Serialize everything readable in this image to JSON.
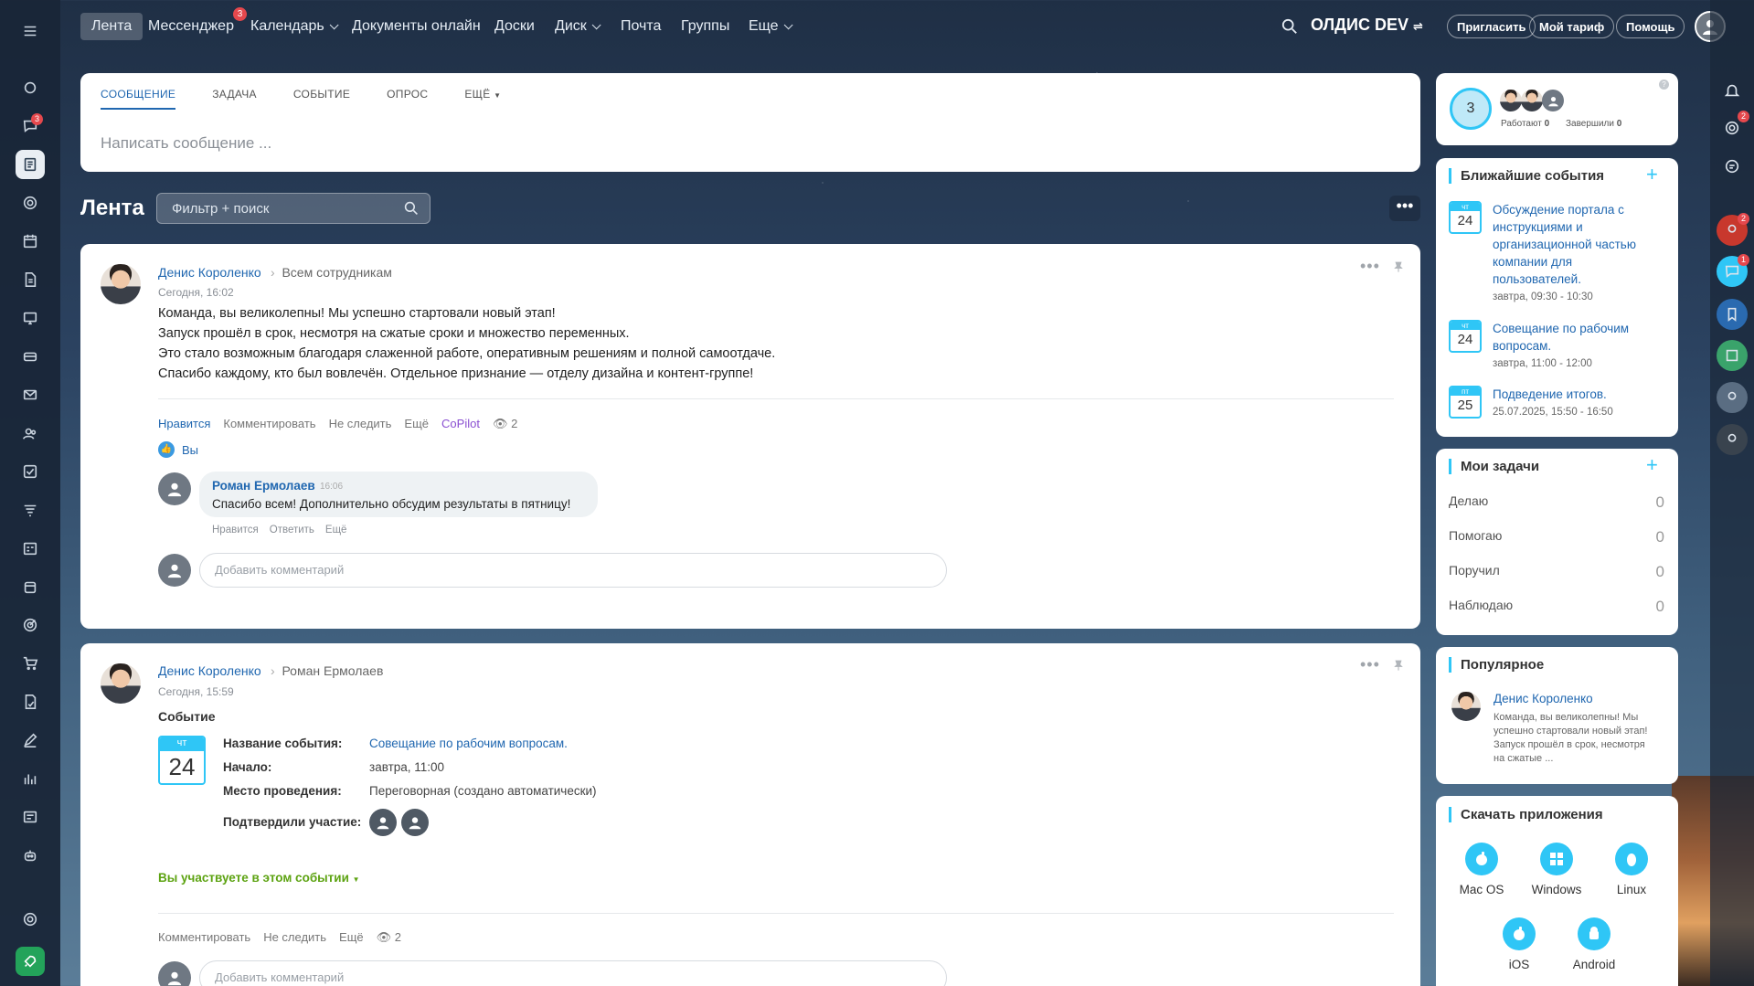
{
  "nav": {
    "items": [
      {
        "label": "Лента",
        "active": true
      },
      {
        "label": "Мессенджер",
        "badge": "3"
      },
      {
        "label": "Календарь",
        "caret": true
      },
      {
        "label": "Документы онлайн"
      },
      {
        "label": "Доски"
      },
      {
        "label": "Диск",
        "caret": true
      },
      {
        "label": "Почта"
      },
      {
        "label": "Группы"
      },
      {
        "label": "Еще",
        "caret": true
      }
    ],
    "brand": "ОЛДИС DEV",
    "invite": "Пригласить",
    "tariff": "Мой тариф",
    "help": "Помощь"
  },
  "left_rail_badge": "3",
  "composer": {
    "tabs": [
      "СООБЩЕНИЕ",
      "ЗАДАЧА",
      "СОБЫТИЕ",
      "ОПРОС",
      "ЕЩЁ"
    ],
    "placeholder": "Написать сообщение ..."
  },
  "feed": {
    "title": "Лента",
    "filter_placeholder": "Фильтр + поиск"
  },
  "post1": {
    "author": "Денис Короленко",
    "to": "Всем сотрудникам",
    "time": "Сегодня, 16:02",
    "lines": [
      "Команда, вы великолепны! Мы успешно стартовали новый этап!",
      "Запуск прошёл в срок, несмотря на сжатые сроки и множество переменных.",
      "Это стало возможным благодаря слаженной работе, оперативным решениям и полной самоотдаче.",
      "Спасибо каждому, кто был вовлечён. Отдельное признание — отделу дизайна и контент-группе!"
    ],
    "actions": {
      "like": "Нравится",
      "comment": "Комментировать",
      "unfollow": "Не следить",
      "more": "Ещё",
      "copilot": "CoPilot",
      "views": "2"
    },
    "liked_by": "Вы",
    "comment": {
      "author": "Роман Ермолаев",
      "time": "16:06",
      "text": "Спасибо всем! Дополнительно обсудим результаты в пятницу!",
      "actions": [
        "Нравится",
        "Ответить",
        "Ещё"
      ]
    },
    "comment_placeholder": "Добавить комментарий"
  },
  "post2": {
    "author": "Денис Короленко",
    "to": "Роман Ермолаев",
    "time": "Сегодня, 15:59",
    "type": "Событие",
    "cal": {
      "dow": "чт",
      "day": "24"
    },
    "fields": {
      "name_label": "Название события:",
      "name_value": "Совещание по рабочим вопросам.",
      "start_label": "Начало:",
      "start_value": "завтра, 11:00",
      "place_label": "Место проведения:",
      "place_value": "Переговорная (создано автоматически)",
      "confirmed_label": "Подтвердили участие:"
    },
    "participate": "Вы участвуете в этом событии",
    "actions": {
      "comment": "Комментировать",
      "unfollow": "Не следить",
      "more": "Ещё",
      "views": "2"
    },
    "comment_placeholder": "Добавить комментарий"
  },
  "stats": {
    "count": "3",
    "working_label": "Работают",
    "working": "0",
    "done_label": "Завершили",
    "done": "0"
  },
  "events": {
    "title": "Ближайшие события",
    "items": [
      {
        "dow": "чт",
        "day": "24",
        "lines": [
          "Обсуждение портала с",
          "инструкциями и",
          "организационной частью",
          "компании для",
          "пользователей."
        ],
        "time": "завтра, 09:30 - 10:30"
      },
      {
        "dow": "чт",
        "day": "24",
        "lines": [
          "Совещание по рабочим",
          "вопросам."
        ],
        "time": "завтра, 11:00 - 12:00"
      },
      {
        "dow": "пт",
        "day": "25",
        "lines": [
          "Подведение итогов."
        ],
        "time": "25.07.2025, 15:50 - 16:50"
      }
    ]
  },
  "tasks": {
    "title": "Мои задачи",
    "rows": [
      {
        "label": "Делаю",
        "n": "0"
      },
      {
        "label": "Помогаю",
        "n": "0"
      },
      {
        "label": "Поручил",
        "n": "0"
      },
      {
        "label": "Наблюдаю",
        "n": "0"
      }
    ]
  },
  "popular": {
    "title": "Популярное",
    "author": "Денис Короленко",
    "lines": [
      "Команда, вы великолепны! Мы",
      "успешно стартовали новый этап!",
      "Запуск прошёл в срок, несмотря",
      "на сжатые ..."
    ]
  },
  "apps": {
    "title": "Скачать приложения",
    "items": [
      "Mac OS",
      "Windows",
      "Linux",
      "iOS",
      "Android"
    ]
  },
  "right_rail_badges": [
    "2",
    "2",
    "1"
  ]
}
